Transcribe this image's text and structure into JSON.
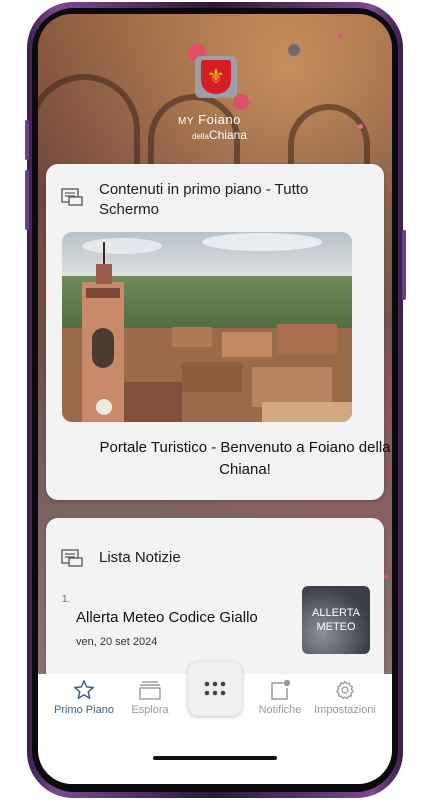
{
  "app": {
    "brand_line1_prefix": "MY",
    "brand_line1": "Foiano",
    "brand_line2_prefix": "della",
    "brand_line2": "Chiana"
  },
  "featured": {
    "section_title": "Contenuti in primo piano - Tutto Schermo",
    "caption": "Portale Turistico - Benvenuto a Foiano della Chiana!"
  },
  "news": {
    "section_title": "Lista Notizie",
    "items": [
      {
        "number": "1.",
        "title": "Allerta Meteo Codice Giallo",
        "date": "ven, 20 set 2024",
        "thumb_line1": "ALLERTA",
        "thumb_line2": "METEO"
      }
    ]
  },
  "nav": {
    "items": [
      {
        "label": "Primo Piano",
        "icon": "star-icon",
        "active": true
      },
      {
        "label": "Esplora",
        "icon": "layers-icon",
        "active": false
      },
      {
        "label": "Notifiche",
        "icon": "notification-icon",
        "active": false
      },
      {
        "label": "Impostazioni",
        "icon": "gear-icon",
        "active": false
      }
    ],
    "center_icon": "grid-menu-icon"
  },
  "colors": {
    "accent": "#3d5f8c",
    "card_bg": "#f3f3f3",
    "crest_red": "#d21f26",
    "crest_gold": "#f3c018"
  }
}
